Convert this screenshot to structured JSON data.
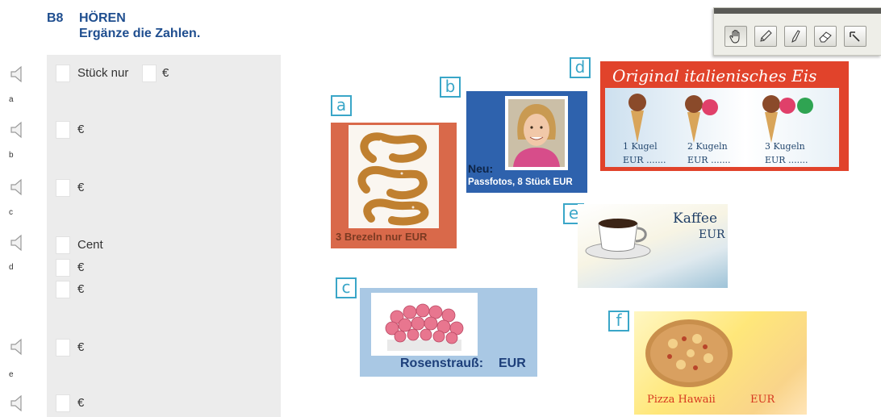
{
  "exercise": {
    "code": "B8",
    "title": "HÖREN",
    "instruction": "Ergänze die Zahlen."
  },
  "rows": {
    "a": {
      "letter": "a",
      "text_mid": "Stück nur",
      "unit": "€"
    },
    "b": {
      "letter": "b",
      "unit": "€"
    },
    "c": {
      "letter": "c",
      "unit": "€"
    },
    "d": {
      "letter": "d",
      "unit1": "Cent",
      "unit2": "€",
      "unit3": "€"
    },
    "e": {
      "letter": "e",
      "unit": "€"
    },
    "f": {
      "unit": "€"
    }
  },
  "toolbar": {
    "tools": [
      "hand-icon",
      "pencil-icon",
      "pen-icon",
      "eraser-icon",
      "undo-arrow-icon"
    ]
  },
  "cards": {
    "a": {
      "tag": "a",
      "caption": "3 Brezeln nur EUR"
    },
    "b": {
      "tag": "b",
      "neu": "Neu:",
      "caption": "Passfotos, 8 Stück EUR"
    },
    "c": {
      "tag": "c",
      "caption": "Rosenstrauß:",
      "eur": "EUR"
    },
    "d": {
      "tag": "d",
      "title": "Original italienisches Eis",
      "k1": "1 Kugel",
      "k2": "2 Kugeln",
      "k3": "3 Kugeln",
      "e1": "EUR .......",
      "e2": "EUR .......",
      "e3": "EUR ......."
    },
    "e": {
      "tag": "e",
      "title": "Kaffee",
      "eur": "EUR"
    },
    "f": {
      "tag": "f",
      "caption": "Pizza Hawaii",
      "eur": "EUR"
    }
  },
  "colors": {
    "heading": "#1f4e8f",
    "tag": "#3aa6c8",
    "panel": "#ececec"
  }
}
